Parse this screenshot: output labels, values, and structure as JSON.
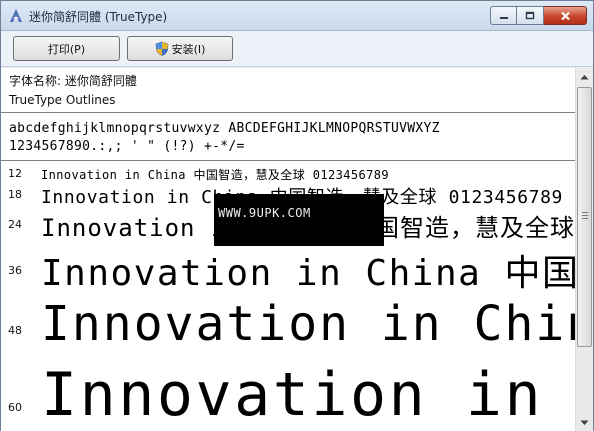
{
  "window": {
    "title": "迷你简舒同體 (TrueType)"
  },
  "toolbar": {
    "print_label": "打印(P)",
    "install_label": "安装(I)"
  },
  "font_info": {
    "name_line": "字体名称: 迷你简舒同體",
    "type_line": "TrueType Outlines"
  },
  "charset": {
    "line1": "abcdefghijklmnopqrstuvwxyz ABCDEFGHIJKLMNOPQRSTUVWXYZ",
    "line2": "1234567890.:,; ' \" (!?) +-*/="
  },
  "samples": [
    {
      "size": "12",
      "text": "Innovation in China 中国智造，慧及全球 0123456789"
    },
    {
      "size": "18",
      "text": "Innovation in China 中国智造，慧及全球 0123456789"
    },
    {
      "size": "24",
      "text": "Innovation in China 中国智造，慧及全球"
    },
    {
      "size": "36",
      "text": "Innovation in China 中国"
    },
    {
      "size": "48",
      "text": "Innovation in China"
    },
    {
      "size": "60",
      "text": "Innovation in China"
    }
  ],
  "watermark": {
    "text": "WWW.9UPK.COM"
  },
  "icons": {
    "app": "font-viewer-icon",
    "install": "shield-icon"
  },
  "colors": {
    "close_button": "#c8462c",
    "titlebar": "#dfe9f5",
    "watermark_bg": "#000000"
  }
}
